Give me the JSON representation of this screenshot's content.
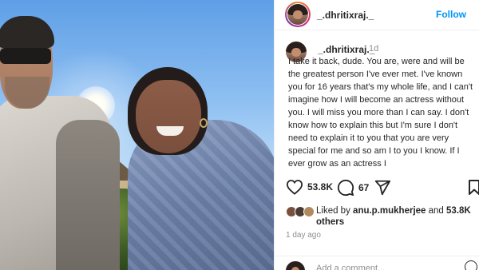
{
  "post": {
    "photo_alt": "",
    "author": "_.dhritixraj._",
    "follow_label": "Follow"
  },
  "caption": {
    "author": "_.dhritixraj._",
    "time": "1d",
    "text": "I take it back, dude. You are, were and will be the greatest person I've ever met. I've known you for 16 years that's my whole life, and I can't imagine how I will become an actress without you. I will miss you more than I can say. I don't know how to explain this but I'm sure I don't need to explain it to you that you are very special for me and so am I to you I know. If I ever grow as an actress I"
  },
  "actions": {
    "like_icon": "heart-icon",
    "like_count": "53.8K",
    "comment_icon": "comment-icon",
    "comment_count": "67",
    "share_icon": "share-icon",
    "save_icon": "bookmark-icon"
  },
  "likes": {
    "prefix": "Liked by",
    "user": "anu.p.mukherjee",
    "and": "and",
    "others_count": "53.8K",
    "others_label": "others"
  },
  "timestamp": "1 day ago",
  "comment_input": {
    "placeholder": "Add a comment..."
  },
  "colors": {
    "accent": "#0095f6",
    "text": "#262626",
    "muted": "#8e8e8e"
  }
}
